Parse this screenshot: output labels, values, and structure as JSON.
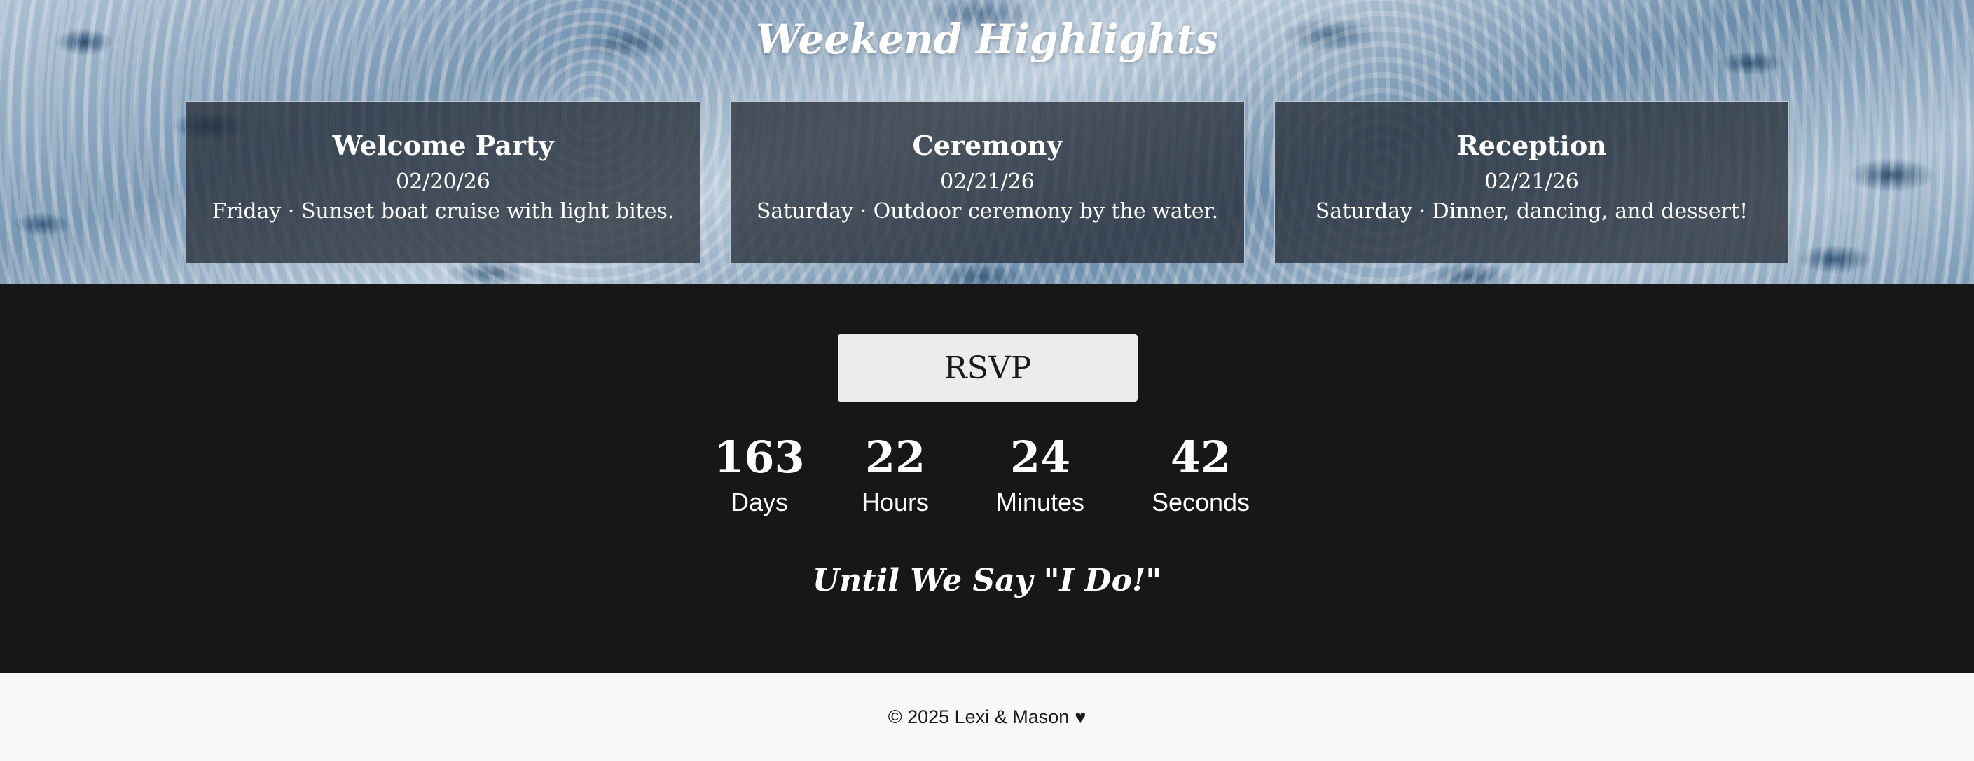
{
  "hero": {
    "title": "Weekend Highlights",
    "events": [
      {
        "title": "Welcome Party",
        "date": "02/20/26",
        "description": "Friday · Sunset boat cruise with light bites."
      },
      {
        "title": "Ceremony",
        "date": "02/21/26",
        "description": "Saturday · Outdoor ceremony by the water."
      },
      {
        "title": "Reception",
        "date": "02/21/26",
        "description": "Saturday · Dinner, dancing, and dessert!"
      }
    ]
  },
  "countdown": {
    "rsvp_label": "RSVP",
    "units": [
      {
        "value": "163",
        "label": "Days"
      },
      {
        "value": "22",
        "label": "Hours"
      },
      {
        "value": "24",
        "label": "Minutes"
      },
      {
        "value": "42",
        "label": "Seconds"
      }
    ],
    "tagline": "Until We Say \"I Do!\""
  },
  "footer": {
    "text": "© 2025 Lexi & Mason",
    "icon": "heart-icon"
  },
  "colors": {
    "section_dark": "#171717",
    "footer_bg": "#f7f8fa",
    "button_bg": "#ececec"
  }
}
